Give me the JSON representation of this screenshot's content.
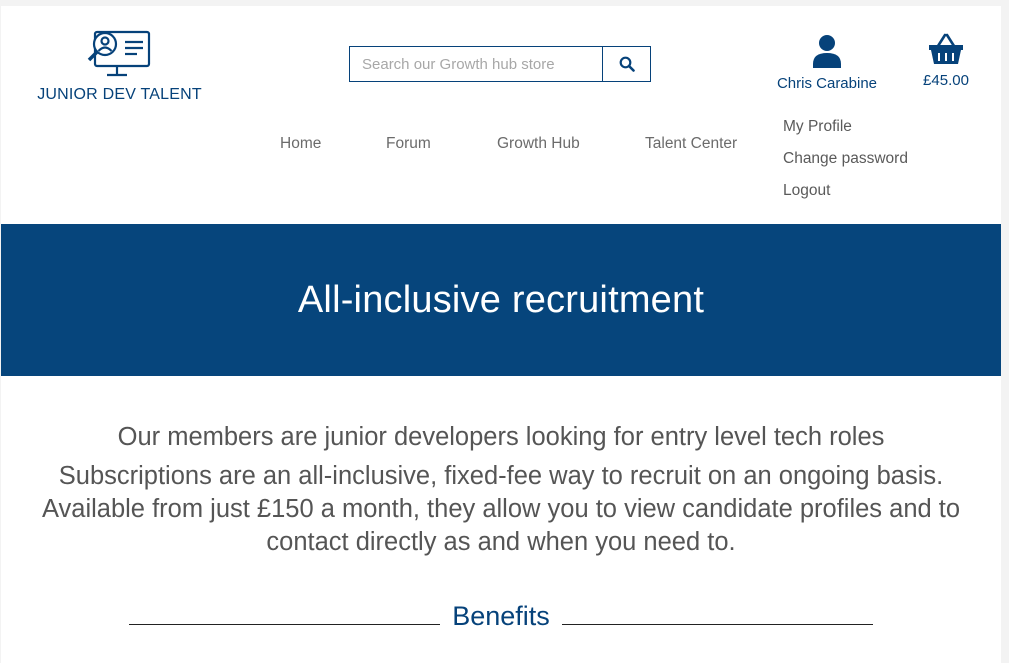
{
  "brand": {
    "name": "JUNIOR DEV TALENT",
    "color": "#06427a"
  },
  "search": {
    "placeholder": "Search our Growth hub store",
    "value": "",
    "button_icon": "search-icon"
  },
  "account": {
    "icon": "user-icon",
    "name": "Chris Carabine"
  },
  "cart": {
    "icon": "basket-icon",
    "total": "£45.00"
  },
  "nav": {
    "items": [
      {
        "label": "Home"
      },
      {
        "label": "Forum"
      },
      {
        "label": "Growth Hub"
      },
      {
        "label": "Talent Center"
      }
    ]
  },
  "account_menu": {
    "items": [
      {
        "label": "My Profile"
      },
      {
        "label": "Change password"
      },
      {
        "label": "Logout"
      }
    ]
  },
  "hero": {
    "title": "All-inclusive recruitment",
    "background": "#06457c"
  },
  "intro": {
    "line1": "Our members are junior developers looking for entry level tech roles",
    "line2": "Subscriptions are an all-inclusive, fixed-fee way to recruit on an ongoing basis. Available from just £150 a month, they allow you to view candidate profiles and to contact directly as and when you need to."
  },
  "section": {
    "heading": "Benefits"
  }
}
